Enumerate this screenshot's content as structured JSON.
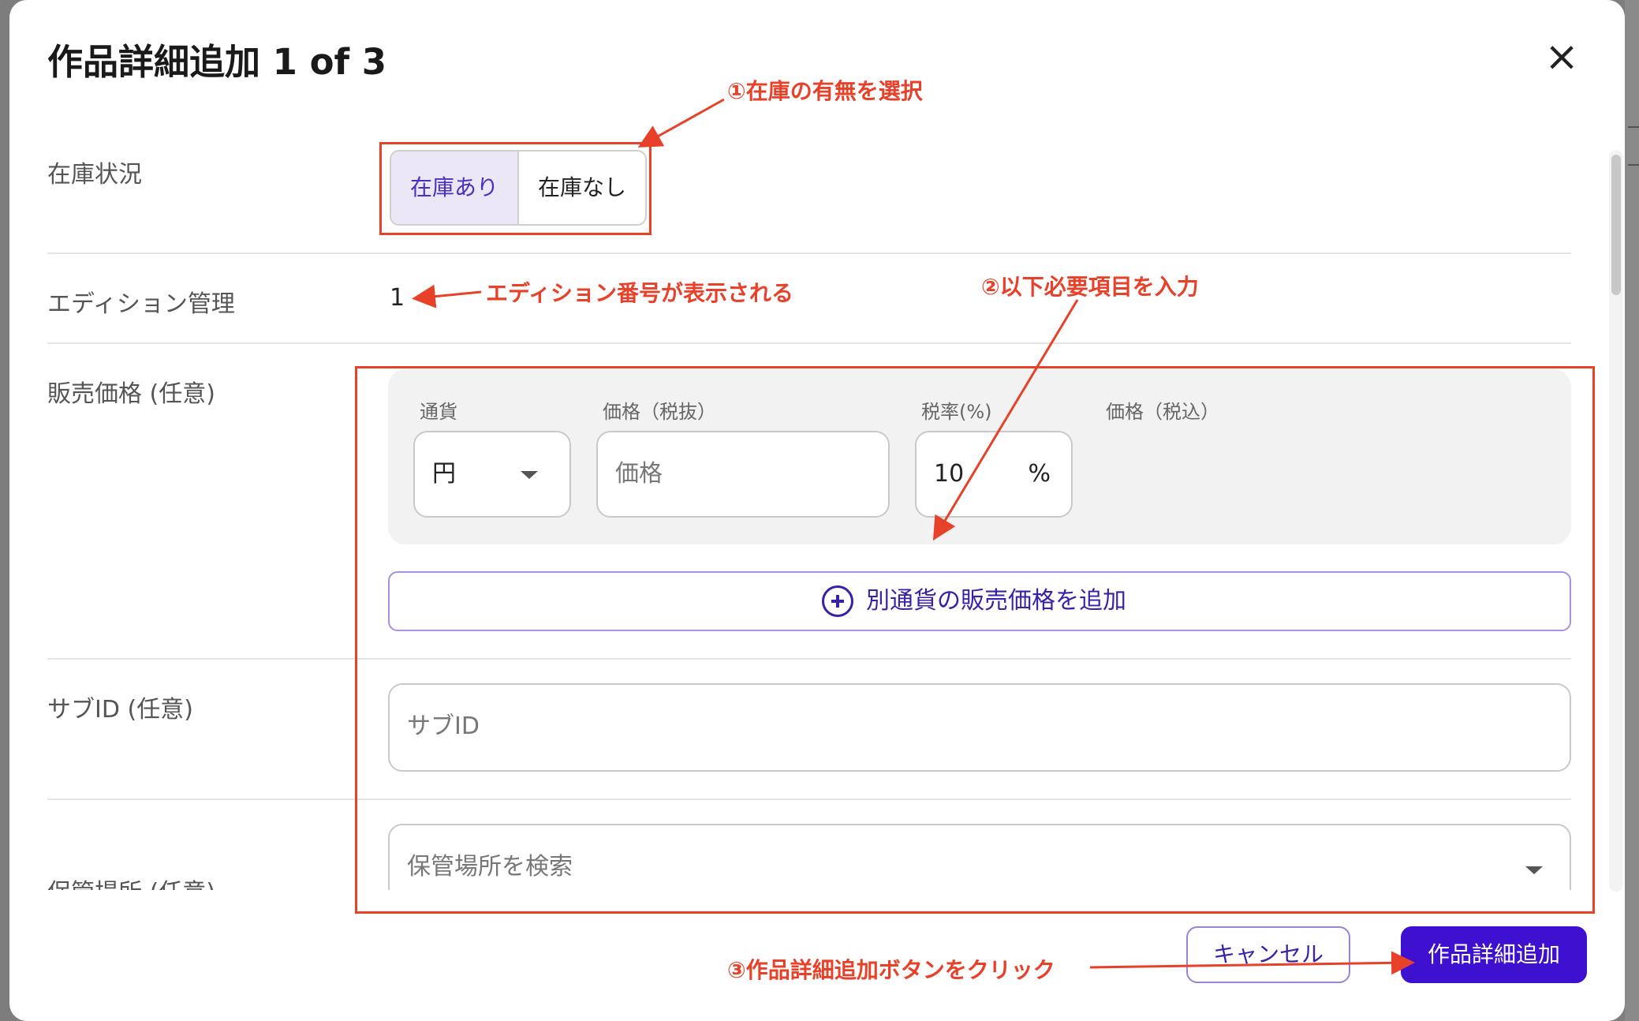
{
  "dialog": {
    "title": "作品詳細追加 1 of 3",
    "close_icon": "×"
  },
  "stock": {
    "label": "在庫状況",
    "options": [
      "在庫あり",
      "在庫なし"
    ],
    "selected": "在庫あり"
  },
  "edition": {
    "label": "エディション管理",
    "value": "1"
  },
  "price": {
    "label": "販売価格 (任意)",
    "currency_label": "通貨",
    "currency_value": "円",
    "price_ex_label": "価格（税抜）",
    "price_ex_placeholder": "価格",
    "tax_rate_label": "税率(%)",
    "tax_rate_value": "10",
    "tax_unit": "%",
    "price_in_label": "価格（税込）",
    "add_currency_label": "別通貨の販売価格を追加"
  },
  "sub_id": {
    "label": "サブID (任意)",
    "placeholder": "サブID"
  },
  "storage": {
    "label": "保管場所 (任意)",
    "placeholder": "保管場所を検索"
  },
  "footer": {
    "cancel_label": "キャンセル",
    "submit_label": "作品詳細追加"
  },
  "annotations": {
    "step1": "①在庫の有無を選択",
    "edition_note": "エディション番号が表示される",
    "step2": "②以下必要項目を入力",
    "step3": "③作品詳細追加ボタンをクリック"
  },
  "colors": {
    "accent": "#3e10d0",
    "annotation": "#e8412a",
    "selected_bg": "#ece7f7"
  }
}
